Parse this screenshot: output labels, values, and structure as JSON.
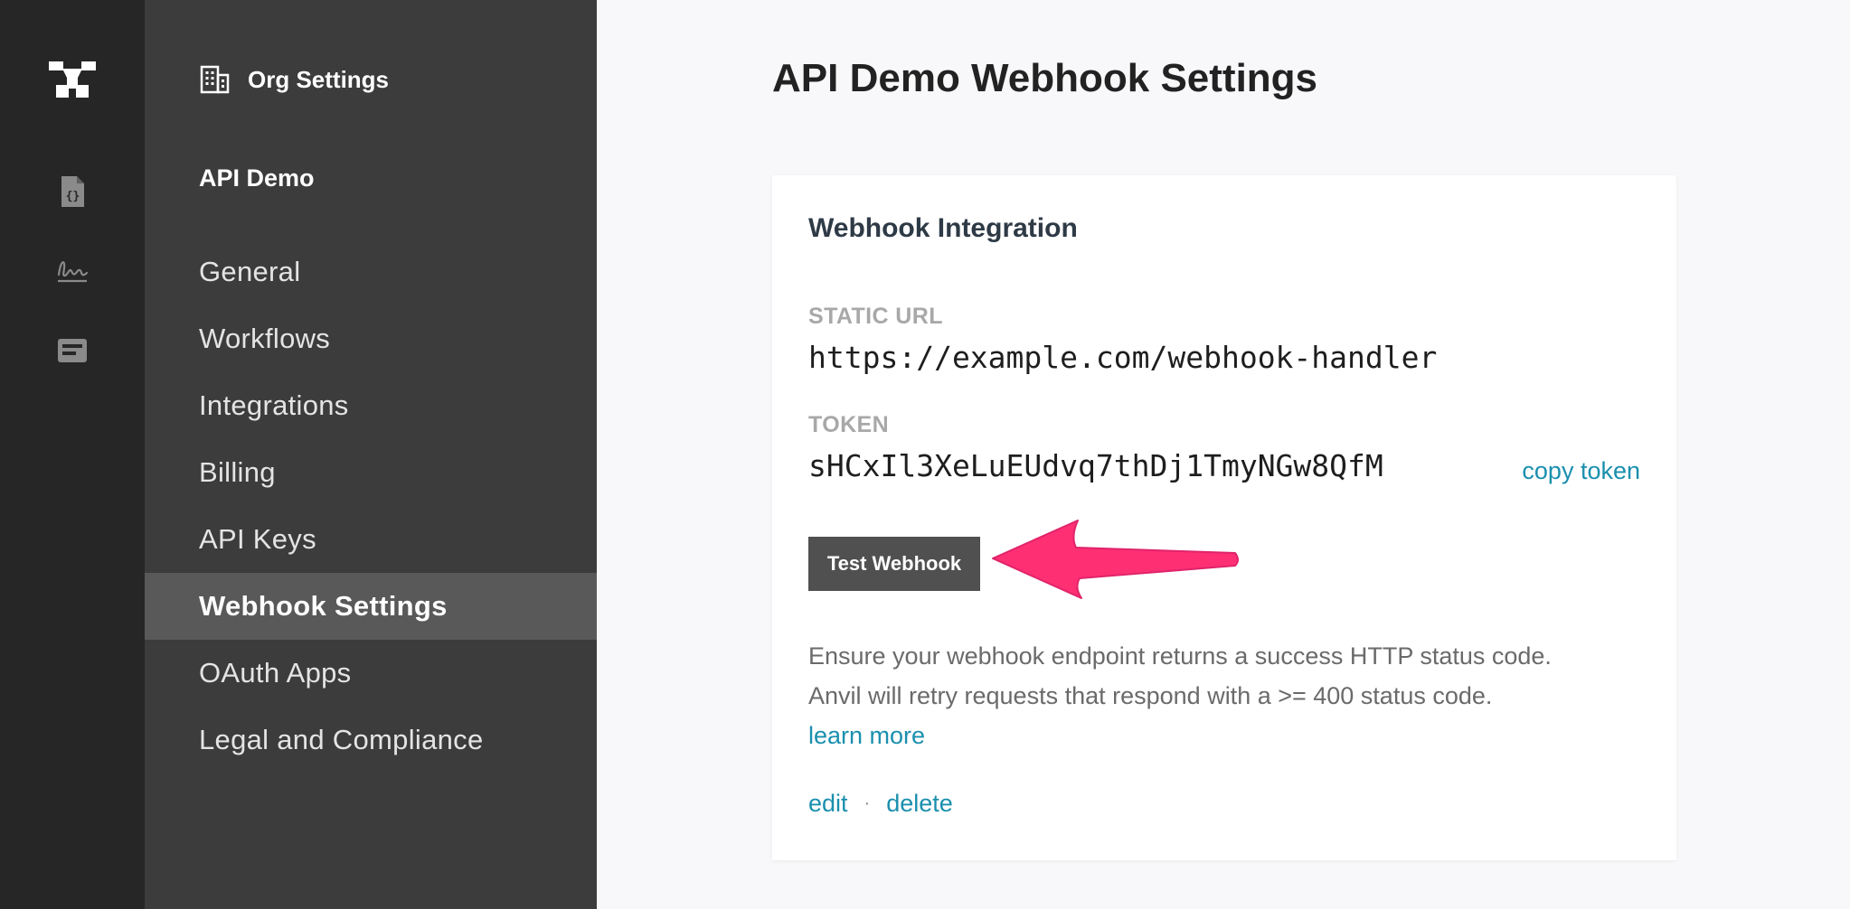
{
  "sidebar": {
    "org_label": "Org Settings",
    "org_name": "API Demo",
    "items": [
      {
        "label": "General",
        "active": false
      },
      {
        "label": "Workflows",
        "active": false
      },
      {
        "label": "Integrations",
        "active": false
      },
      {
        "label": "Billing",
        "active": false
      },
      {
        "label": "API Keys",
        "active": false
      },
      {
        "label": "Webhook Settings",
        "active": true
      },
      {
        "label": "OAuth Apps",
        "active": false
      },
      {
        "label": "Legal and Compliance",
        "active": false
      }
    ]
  },
  "rail": {
    "icons": [
      "anvil-logo-icon",
      "document-code-icon",
      "signature-icon",
      "form-icon"
    ]
  },
  "page": {
    "title": "API Demo Webhook Settings"
  },
  "card": {
    "title": "Webhook Integration",
    "static_url_label": "STATIC URL",
    "static_url": "https://example.com/webhook-handler",
    "token_label": "TOKEN",
    "token": "sHCxIl3XeLuEUdvq7thDj1TmyNGw8QfM",
    "copy_token": "copy token",
    "test_button": "Test Webhook",
    "help_line1": "Ensure your webhook endpoint returns a success HTTP status code.",
    "help_line2": "Anvil will retry requests that respond with a >= 400 status code.",
    "learn_more": "learn more",
    "edit": "edit",
    "separator": "·",
    "delete": "delete"
  },
  "colors": {
    "rail_bg": "#262626",
    "sidebar_bg": "#3c3c3c",
    "active_item_bg": "#595959",
    "link": "#1a8fae",
    "button_bg": "#505050",
    "annotation_arrow": "#ff2f74"
  }
}
